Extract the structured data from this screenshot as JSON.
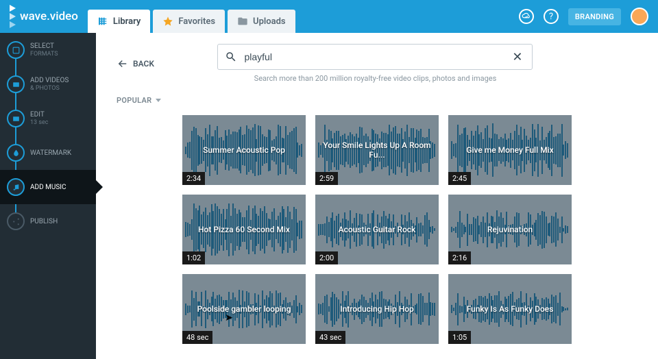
{
  "brand": "wave.video",
  "tabs": [
    {
      "label": "Library",
      "icon": "library",
      "active": true
    },
    {
      "label": "Favorites",
      "icon": "star",
      "active": false
    },
    {
      "label": "Uploads",
      "icon": "folder",
      "active": false
    }
  ],
  "branding_btn": "BRANDING",
  "sidebar": [
    {
      "label": "SELECT",
      "sub": "FORMATS",
      "icon": "formats"
    },
    {
      "label": "ADD VIDEOS",
      "sub": "& PHOTOS",
      "icon": "media"
    },
    {
      "label": "EDIT",
      "sub": "13 sec",
      "icon": "edit"
    },
    {
      "label": "WATERMARK",
      "sub": "",
      "icon": "drop"
    },
    {
      "label": "ADD MUSIC",
      "sub": "",
      "icon": "music",
      "active": true
    },
    {
      "label": "PUBLISH",
      "sub": "",
      "icon": "share",
      "dim": true
    }
  ],
  "back_label": "BACK",
  "search": {
    "value": "playful",
    "placeholder": "Search"
  },
  "search_sub": "Search more than 200 million royalty-free video clips, photos and images",
  "sort": "POPULAR",
  "tracks": [
    {
      "title": "Summer Acoustic Pop",
      "dur": "2:34",
      "density": "high"
    },
    {
      "title": "Your Smile Lights Up A Room Fu...",
      "dur": "2:59",
      "density": "high"
    },
    {
      "title": "Give me Money Full Mix",
      "dur": "2:45",
      "density": "high"
    },
    {
      "title": "Hot Pizza 60 Second Mix",
      "dur": "1:02",
      "density": "high"
    },
    {
      "title": "Acoustic Guitar Rock",
      "dur": "2:00",
      "density": "mid"
    },
    {
      "title": "Rejuvination",
      "dur": "2:16",
      "density": "mid"
    },
    {
      "title": "Poolside gambler looping",
      "dur": "48 sec",
      "density": "mid"
    },
    {
      "title": "Introducing Hip Hop",
      "dur": "43 sec",
      "density": "mid"
    },
    {
      "title": "Funky Is As Funky Does",
      "dur": "1:05",
      "density": "mid"
    }
  ]
}
